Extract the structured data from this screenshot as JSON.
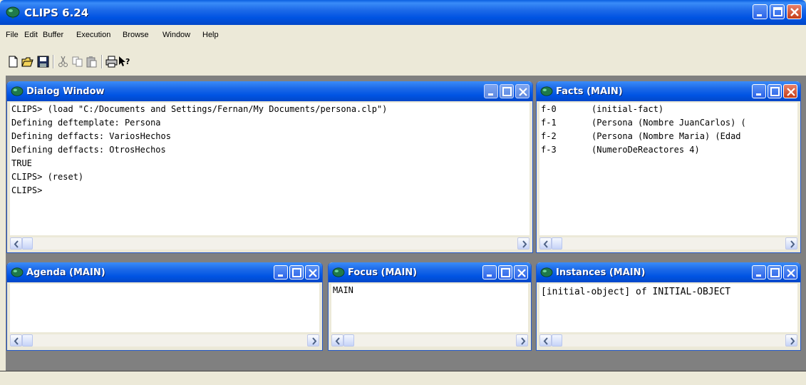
{
  "app": {
    "title": "CLIPS 6.24"
  },
  "menu": {
    "items": [
      "File",
      "Edit",
      "Buffer",
      "Execution",
      "Browse",
      "Window",
      "Help"
    ]
  },
  "toolbar": {
    "icons": [
      "new-file-icon",
      "open-folder-icon",
      "save-icon",
      "cut-icon",
      "copy-icon",
      "paste-icon",
      "print-icon",
      "context-help-icon"
    ]
  },
  "dialog": {
    "title": "Dialog Window",
    "lines": [
      "CLIPS> (load \"C:/Documents and Settings/Fernan/My Documents/persona.clp\")",
      "Defining deftemplate: Persona",
      "Defining deffacts: VariosHechos",
      "Defining deffacts: OtrosHechos",
      "TRUE",
      "CLIPS> (reset)",
      "CLIPS>"
    ]
  },
  "facts": {
    "title": "Facts (MAIN)",
    "rows": [
      {
        "id": "f-0",
        "fact": "(initial-fact)"
      },
      {
        "id": "f-1",
        "fact": "(Persona (Nombre JuanCarlos) ("
      },
      {
        "id": "f-2",
        "fact": "(Persona (Nombre Maria) (Edad"
      },
      {
        "id": "f-3",
        "fact": "(NumeroDeReactores 4)"
      }
    ]
  },
  "agenda": {
    "title": "Agenda (MAIN)",
    "lines": []
  },
  "focus": {
    "title": "Focus (MAIN)",
    "lines": [
      "MAIN"
    ]
  },
  "instances": {
    "title": "Instances (MAIN)",
    "lines": [
      "[initial-object] of INITIAL-OBJECT"
    ]
  },
  "colors": {
    "titlebar": "#0054E3",
    "close": "#C43D18",
    "face": "#ECE9D8",
    "mdi": "#808080"
  }
}
